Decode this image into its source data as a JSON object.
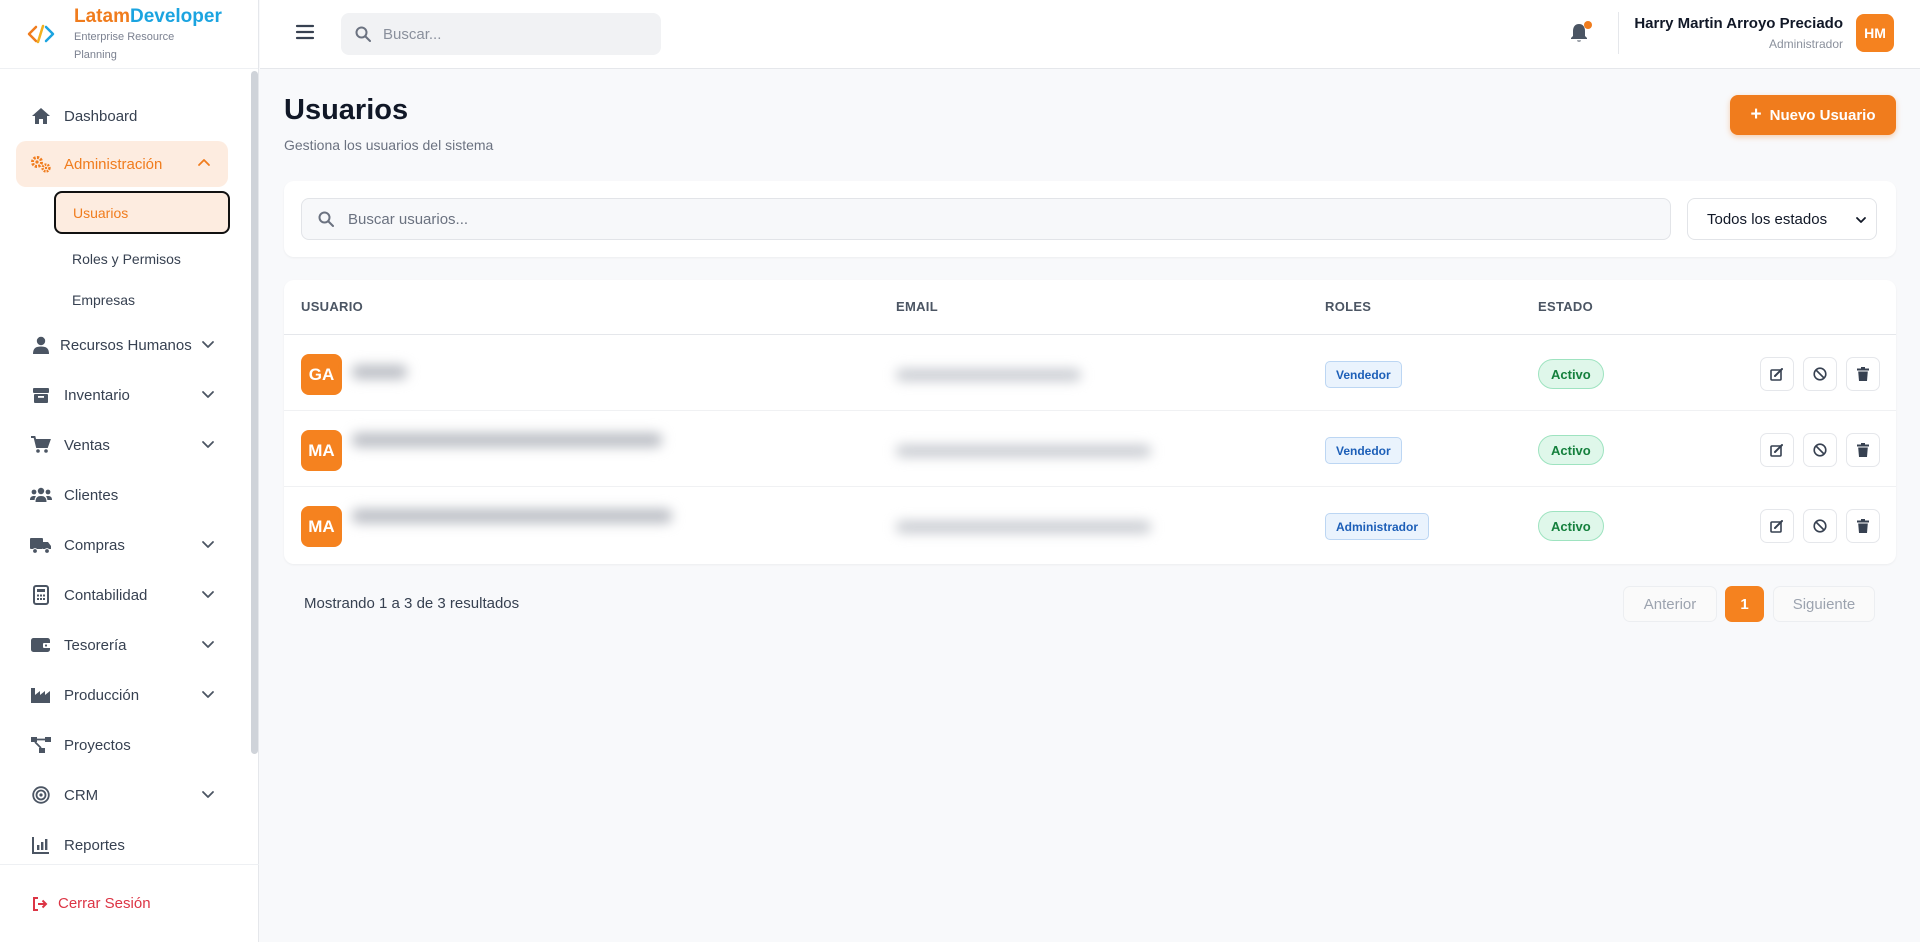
{
  "brand": {
    "name_part1": "Latam",
    "name_part2": "Developer",
    "subtitle": "Enterprise Resource Planning"
  },
  "topbar": {
    "search_placeholder": "Buscar...",
    "user_name": "Harry Martin Arroyo Preciado",
    "user_role": "Administrador",
    "user_initials": "HM"
  },
  "sidebar": {
    "items": [
      {
        "label": "Dashboard",
        "icon": "home-icon"
      },
      {
        "label": "Administración",
        "icon": "gears-icon",
        "expanded": true,
        "children": [
          {
            "label": "Usuarios"
          },
          {
            "label": "Roles y Permisos"
          },
          {
            "label": "Empresas"
          }
        ]
      },
      {
        "label": "Recursos Humanos",
        "icon": "user-icon"
      },
      {
        "label": "Inventario",
        "icon": "box-icon"
      },
      {
        "label": "Ventas",
        "icon": "cart-icon"
      },
      {
        "label": "Clientes",
        "icon": "users-icon"
      },
      {
        "label": "Compras",
        "icon": "truck-icon"
      },
      {
        "label": "Contabilidad",
        "icon": "calculator-icon"
      },
      {
        "label": "Tesorería",
        "icon": "wallet-icon"
      },
      {
        "label": "Producción",
        "icon": "industry-icon"
      },
      {
        "label": "Proyectos",
        "icon": "project-diagram-icon"
      },
      {
        "label": "CRM",
        "icon": "target-icon"
      },
      {
        "label": "Reportes",
        "icon": "chart-line-icon"
      }
    ],
    "logout_label": "Cerrar Sesión"
  },
  "main": {
    "title": "Usuarios",
    "subtitle": "Gestiona los usuarios del sistema",
    "new_button_label": "Nuevo Usuario",
    "search_placeholder": "Buscar usuarios...",
    "status_filter": "Todos los estados",
    "table": {
      "headers": [
        "USUARIO",
        "EMAIL",
        "ROLES",
        "ESTADO"
      ],
      "rows": [
        {
          "initials": "GA",
          "role": "Vendedor",
          "status": "Activo"
        },
        {
          "initials": "MA",
          "role": "Vendedor",
          "status": "Activo"
        },
        {
          "initials": "MA",
          "role": "Administrador",
          "status": "Activo"
        }
      ]
    },
    "results_text": "Mostrando 1 a 3 de 3 resultados",
    "pagination": {
      "prev": "Anterior",
      "current": "1",
      "next": "Siguiente"
    }
  },
  "colors": {
    "accent": "#f07c1d",
    "brand_blue": "#1ba4e0",
    "danger": "#dc3545",
    "success": "#15803d"
  }
}
